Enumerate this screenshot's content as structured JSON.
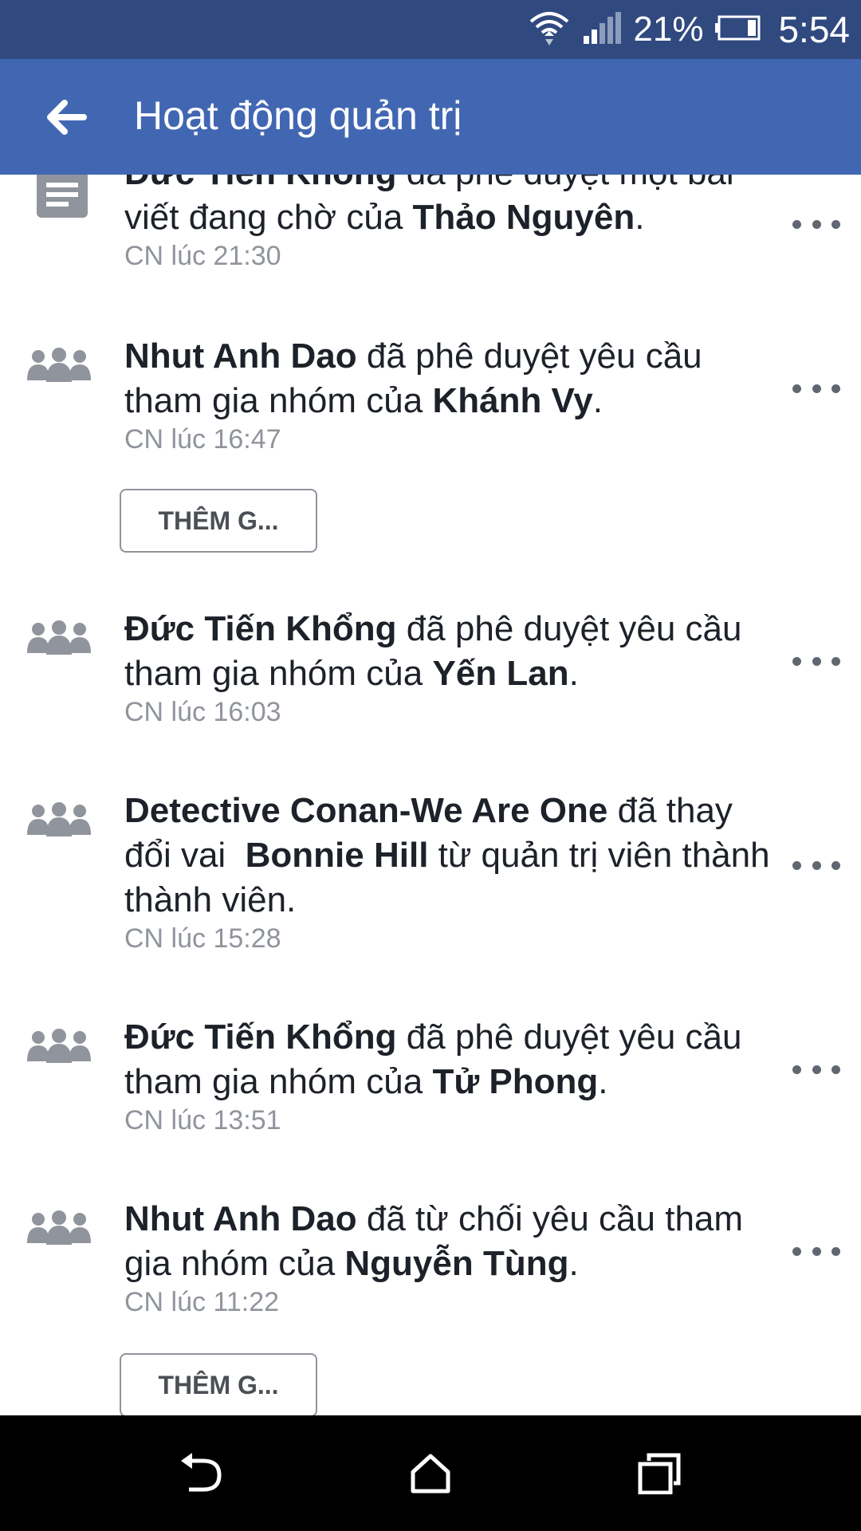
{
  "status_bar": {
    "battery": "21%",
    "time": "5:54"
  },
  "appbar": {
    "title": "Hoạt động quản trị"
  },
  "items": [
    {
      "actor": "Đức Tiến Khổng",
      "action": " đã phê duyệt một bài viết đang chờ của ",
      "target": "Thảo Nguyên",
      "tail": ".",
      "time": "CN lúc 21:30",
      "icon": "document-icon"
    },
    {
      "actor": "Nhut Anh Dao",
      "action": " đã phê duyệt yêu cầu tham gia nhóm của ",
      "target": "Khánh Vy",
      "tail": ".",
      "time": "CN lúc 16:47",
      "icon": "group-icon",
      "button": "THÊM G..."
    },
    {
      "actor": "Đức Tiến Khổng",
      "action": " đã phê duyệt yêu cầu tham gia nhóm của ",
      "target": "Yến Lan",
      "tail": ".",
      "time": "CN lúc 16:03",
      "icon": "group-icon"
    },
    {
      "actor": "Detective Conan-We Are One",
      "action": " đã thay đổi vai  ",
      "target": "Bonnie Hill",
      "tail": " từ quản trị viên thành thành viên.",
      "time": "CN lúc 15:28",
      "icon": "group-icon"
    },
    {
      "actor": "Đức Tiến Khổng",
      "action": " đã phê duyệt yêu cầu tham gia nhóm của ",
      "target": "Tử Phong",
      "tail": ".",
      "time": "CN lúc 13:51",
      "icon": "group-icon"
    },
    {
      "actor": "Nhut Anh Dao",
      "action": " đã từ chối yêu cầu tham gia nhóm của ",
      "target": "Nguyễn Tùng",
      "tail": ".",
      "time": "CN lúc 11:22",
      "icon": "group-icon",
      "button": "THÊM G..."
    }
  ],
  "colors": {
    "appbar": "#4267b2",
    "statusbar": "#30497f",
    "meta": "#90949c"
  },
  "nav": {
    "icons": [
      "back-nav-icon",
      "home-nav-icon",
      "recents-nav-icon"
    ]
  }
}
